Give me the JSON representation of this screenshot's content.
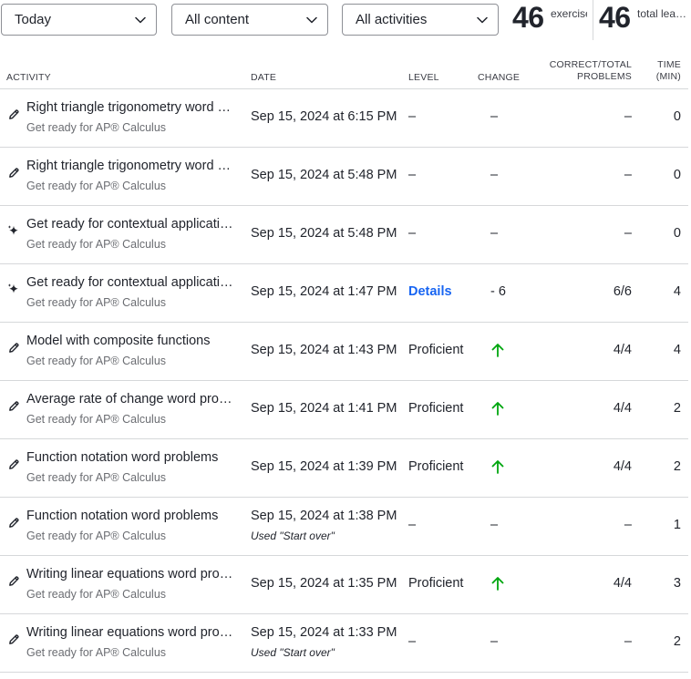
{
  "filters": {
    "time_range": "Today",
    "content": "All content",
    "activities": "All activities"
  },
  "stats": {
    "exercise_minutes": {
      "value": "46",
      "label": "exercise min"
    },
    "total_learning": {
      "value": "46",
      "label": "total learning..."
    }
  },
  "table": {
    "headers": {
      "activity": "ACTIVITY",
      "date": "DATE",
      "level": "LEVEL",
      "change": "CHANGE",
      "correct_total_line1": "CORRECT/TOTAL",
      "correct_total_line2": "PROBLEMS",
      "time_line1": "TIME",
      "time_line2": "(MIN)"
    },
    "rows": [
      {
        "icon": "pencil-icon",
        "title": "Right triangle trigonometry word problems",
        "subtitle": "Get ready for AP® Calculus",
        "date": "Sep 15, 2024 at 6:15 PM",
        "note": "",
        "level": "–",
        "change": "–",
        "correct": "–",
        "time": "0"
      },
      {
        "icon": "pencil-icon",
        "title": "Right triangle trigonometry word problems",
        "subtitle": "Get ready for AP® Calculus",
        "date": "Sep 15, 2024 at 5:48 PM",
        "note": "",
        "level": "–",
        "change": "–",
        "correct": "–",
        "time": "0"
      },
      {
        "icon": "sparkle-icon",
        "title": "Get ready for contextual applications",
        "subtitle": "Get ready for AP® Calculus",
        "date": "Sep 15, 2024 at 5:48 PM",
        "note": "",
        "level": "–",
        "change": "–",
        "correct": "–",
        "time": "0"
      },
      {
        "icon": "sparkle-icon",
        "title": "Get ready for contextual applications",
        "subtitle": "Get ready for AP® Calculus",
        "date": "Sep 15, 2024 at 1:47 PM",
        "note": "",
        "level": "Details",
        "change": "- 6",
        "correct": "6/6",
        "time": "4"
      },
      {
        "icon": "pencil-icon",
        "title": "Model with composite functions",
        "subtitle": "Get ready for AP® Calculus",
        "date": "Sep 15, 2024 at 1:43 PM",
        "note": "",
        "level": "Proficient",
        "change": "up-arrow",
        "correct": "4/4",
        "time": "4"
      },
      {
        "icon": "pencil-icon",
        "title": "Average rate of change word problems",
        "subtitle": "Get ready for AP® Calculus",
        "date": "Sep 15, 2024 at 1:41 PM",
        "note": "",
        "level": "Proficient",
        "change": "up-arrow",
        "correct": "4/4",
        "time": "2"
      },
      {
        "icon": "pencil-icon",
        "title": "Function notation word problems",
        "subtitle": "Get ready for AP® Calculus",
        "date": "Sep 15, 2024 at 1:39 PM",
        "note": "",
        "level": "Proficient",
        "change": "up-arrow",
        "correct": "4/4",
        "time": "2"
      },
      {
        "icon": "pencil-icon",
        "title": "Function notation word problems",
        "subtitle": "Get ready for AP® Calculus",
        "date": "Sep 15, 2024 at 1:38 PM",
        "note": "Used \"Start over\"",
        "level": "–",
        "change": "–",
        "correct": "–",
        "time": "1"
      },
      {
        "icon": "pencil-icon",
        "title": "Writing linear equations word problems",
        "subtitle": "Get ready for AP® Calculus",
        "date": "Sep 15, 2024 at 1:35 PM",
        "note": "",
        "level": "Proficient",
        "change": "up-arrow",
        "correct": "4/4",
        "time": "3"
      },
      {
        "icon": "pencil-icon",
        "title": "Writing linear equations word problems",
        "subtitle": "Get ready for AP® Calculus",
        "date": "Sep 15, 2024 at 1:33 PM",
        "note": "Used \"Start over\"",
        "level": "–",
        "change": "–",
        "correct": "–",
        "time": "2"
      }
    ]
  },
  "colors": {
    "link": "#1865f2",
    "positive": "#00a60e",
    "text": "#21242c",
    "muted": "#6b6d72",
    "divider": "#d6d8da"
  }
}
